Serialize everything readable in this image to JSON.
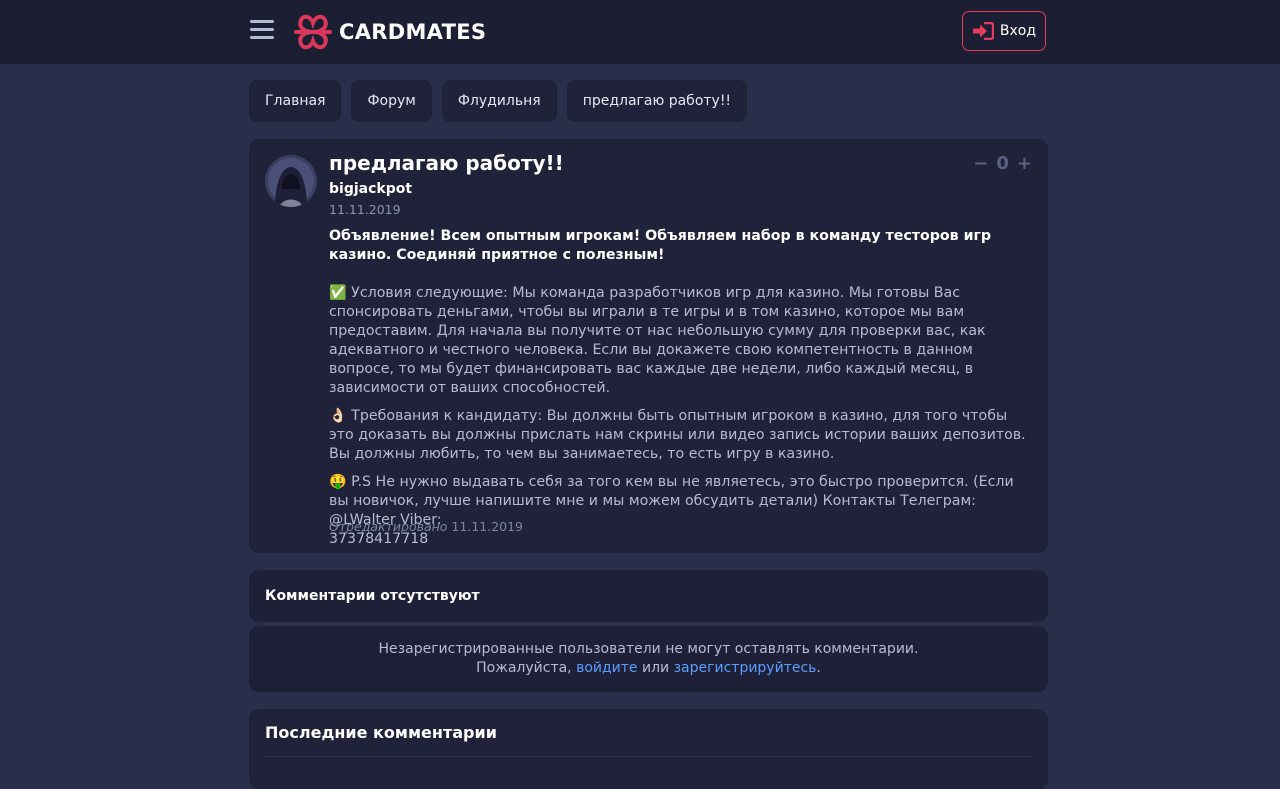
{
  "header": {
    "logo_text": "CARDMATES",
    "login_label": "Вход",
    "accent": "#e23b5b"
  },
  "breadcrumbs": [
    {
      "label": "Главная"
    },
    {
      "label": "Форум"
    },
    {
      "label": "Флудильня"
    },
    {
      "label": "предлагаю работу!!"
    }
  ],
  "post": {
    "title": "предлагаю работу!!",
    "author": "bigjackpot",
    "date": "11.11.2019",
    "votes": "0",
    "vote_minus": "−",
    "vote_plus": "+",
    "lead": "Объявление! Всем опытным игрокам! Объявляем набор в команду тесторов игр казино. Соединяй приятное с полезным!",
    "paragraphs": [
      "✅ Условия следующие: Мы команда разработчиков игр для казино. Мы готовы Вас спонсировать деньгами, чтобы вы играли в те игры и в том казино, которое мы вам предоставим. Для начала вы получите от нас небольшую сумму для проверки вас, как адекватного и честного человека. Если вы докажете свою компетентность в данном вопросе, то мы будет финансировать вас каждые две недели, либо каждый месяц, в зависимости от ваших способностей.",
      "👌🏻 Требования к кандидату: Вы должны быть опытным игроком в казино, для того чтобы это доказать вы должны прислать нам скрины или видео запись истории ваших депозитов. Вы должны любить, то чем вы занимаетесь, то есть игру в казино.",
      "🤑 P.S Не нужно выдавать себя за того кем вы не являетесь, это быстро проверится. (Если вы новичок, лучше напишите мне и мы можем обсудить детали) Контакты Телеграм: @LWalter Viber:"
    ],
    "phone": "37378417718",
    "edited_label": "Отредактировано",
    "edited_date": "11.11.2019"
  },
  "comments": {
    "empty_label": "Комментарии отсутствуют",
    "guest_line1": "Незарегистрированные пользователи не могут оставлять комментарии.",
    "guest_prefix": "Пожалуйста,",
    "login_link": "войдите",
    "or_text": "или",
    "register_link": "зарегистрируйтесь",
    "period": "."
  },
  "recent": {
    "title": "Последние комментарии"
  }
}
